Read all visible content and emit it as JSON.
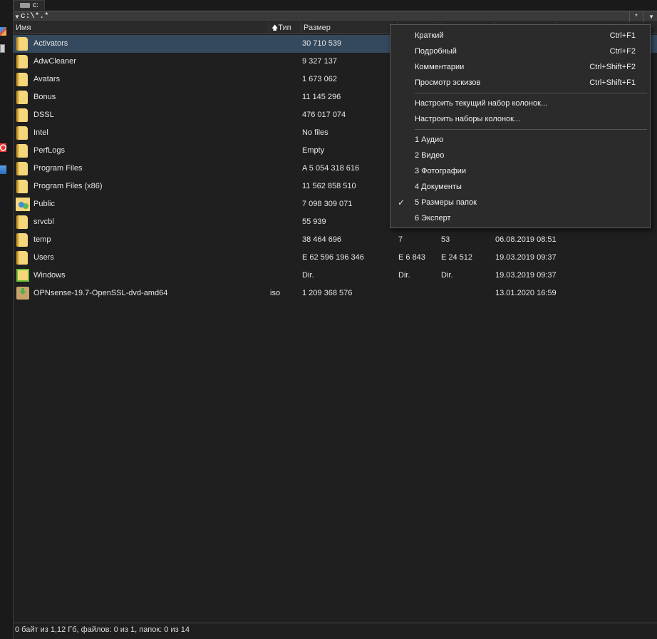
{
  "drive_tab": {
    "label": "c:"
  },
  "path": {
    "text": "c:\\*.*",
    "filter_label": "*"
  },
  "columns": {
    "name": "Имя",
    "type": "Тип",
    "size": "Размер"
  },
  "files": [
    {
      "icon": "folder-icon",
      "name": "Activators",
      "type": "",
      "size": "30 710 539",
      "files": "",
      "dirs": "",
      "date": ""
    },
    {
      "icon": "folder-icon",
      "name": "AdwCleaner",
      "type": "",
      "size": "9 327 137",
      "files": "",
      "dirs": "",
      "date": ""
    },
    {
      "icon": "folder-icon",
      "name": "Avatars",
      "type": "",
      "size": "1 673 062",
      "files": "",
      "dirs": "",
      "date": ""
    },
    {
      "icon": "folder-icon",
      "name": "Bonus",
      "type": "",
      "size": "11 145 296",
      "files": "",
      "dirs": "",
      "date": ""
    },
    {
      "icon": "folder-icon",
      "name": "DSSL",
      "type": "",
      "size": "476 017 074",
      "files": "",
      "dirs": "",
      "date": ""
    },
    {
      "icon": "folder-icon",
      "name": "Intel",
      "type": "",
      "size": "No files",
      "files": "",
      "dirs": "",
      "date": ""
    },
    {
      "icon": "folder-icon",
      "name": "PerfLogs",
      "type": "",
      "size": "Empty",
      "files": "",
      "dirs": "",
      "date": ""
    },
    {
      "icon": "folder-icon",
      "name": "Program Files",
      "type": "",
      "size": "A 5 054 318 616",
      "files": "",
      "dirs": "",
      "date": ""
    },
    {
      "icon": "folder-icon",
      "name": "Program Files (x86)",
      "type": "",
      "size": "11 562 858 510",
      "files": "",
      "dirs": "",
      "date": ""
    },
    {
      "icon": "public-folder-icon",
      "name": "Public",
      "type": "",
      "size": "7 098 309 071",
      "files": "",
      "dirs": "",
      "date": ""
    },
    {
      "icon": "folder-icon",
      "name": "srvcbl",
      "type": "",
      "size": "55 939",
      "files": "",
      "dirs": "",
      "date": ""
    },
    {
      "icon": "folder-icon",
      "name": "temp",
      "type": "",
      "size": "38 464 696",
      "files": "7",
      "dirs": "53",
      "date": "06.08.2019 08:51"
    },
    {
      "icon": "folder-icon",
      "name": "Users",
      "type": "",
      "size": "E 62 596 196 346",
      "files": "E 6 843",
      "dirs": "E 24 512",
      "date": "19.03.2019 09:37"
    },
    {
      "icon": "windows-folder-icon",
      "name": "Windows",
      "type": "",
      "size": "Dir.",
      "files": "Dir.",
      "dirs": "Dir.",
      "date": "19.03.2019 09:37"
    },
    {
      "icon": "iso-file-icon",
      "name": "OPNsense-19.7-OpenSSL-dvd-amd64",
      "type": "iso",
      "size": "1 209 368 576",
      "files": "",
      "dirs": "",
      "date": "13.01.2020 16:59"
    }
  ],
  "status": {
    "text": "0 байт из 1,12 Гб, файлов: 0 из 1, папок: 0 из 14"
  },
  "menu": {
    "items": [
      {
        "label": "Краткий",
        "shortcut": "Ctrl+F1"
      },
      {
        "label": "Подробный",
        "shortcut": "Ctrl+F2"
      },
      {
        "label": "Комментарии",
        "shortcut": "Ctrl+Shift+F2"
      },
      {
        "label": "Просмотр эскизов",
        "shortcut": "Ctrl+Shift+F1"
      },
      {
        "label": "Настроить текущий набор колонок...",
        "shortcut": ""
      },
      {
        "label": "Настроить наборы колонок...",
        "shortcut": ""
      },
      {
        "label": "1 Аудио",
        "shortcut": ""
      },
      {
        "label": "2 Видео",
        "shortcut": ""
      },
      {
        "label": "3 Фотографии",
        "shortcut": ""
      },
      {
        "label": "4 Документы",
        "shortcut": ""
      },
      {
        "label": "5 Размеры папок",
        "shortcut": "",
        "checked": true
      },
      {
        "label": "6 Эксперт",
        "shortcut": ""
      }
    ]
  },
  "colors": {
    "background": "#1f1f1f",
    "selection": "#34495e",
    "menu_bg": "#2b2b2b",
    "text": "#e6e6e6"
  }
}
